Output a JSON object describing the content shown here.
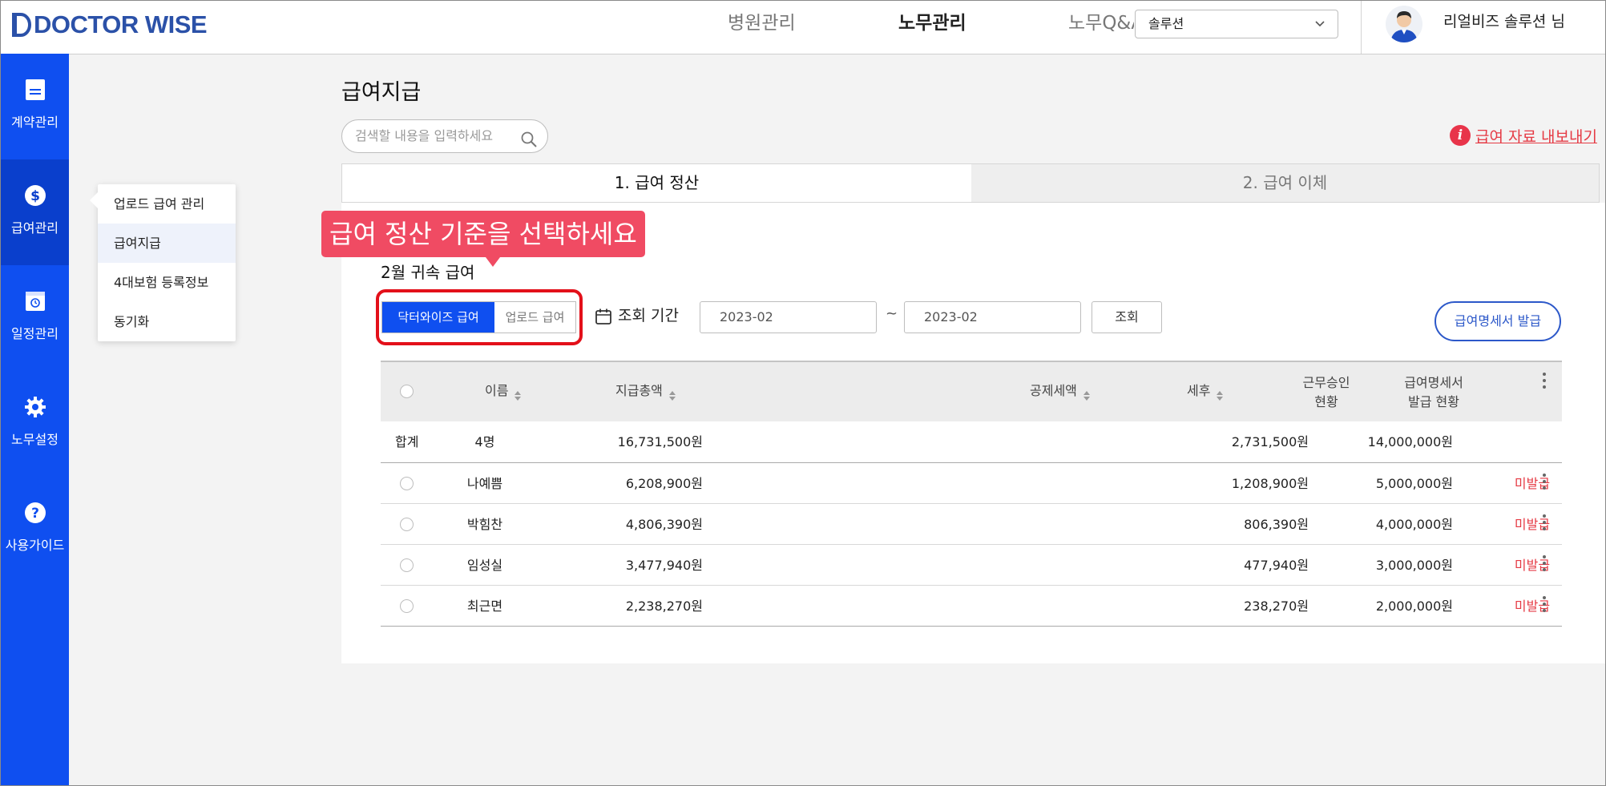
{
  "header": {
    "logo": "DOCTOR WISE",
    "nav": [
      "병원관리",
      "노무관리",
      "노무Q&A"
    ],
    "select_value": "솔루션",
    "user_name": "리얼비즈 솔루션 님"
  },
  "sidebar": {
    "items": [
      {
        "label": "계약관리",
        "icon": "document-icon"
      },
      {
        "label": "급여관리",
        "icon": "dollar-icon"
      },
      {
        "label": "일정관리",
        "icon": "calendar-icon"
      },
      {
        "label": "노무설정",
        "icon": "gear-icon"
      },
      {
        "label": "사용가이드",
        "icon": "help-icon"
      }
    ],
    "active_index": 1
  },
  "flyout": {
    "items": [
      "업로드 급여 관리",
      "급여지급",
      "4대보험 등록정보",
      "동기화"
    ],
    "selected_index": 1
  },
  "page": {
    "title": "급여지급",
    "search_placeholder": "검색할 내용을 입력하세요",
    "export_label": "급여 자료 내보내기",
    "tabs": [
      "1. 급여 정산",
      "2. 급여 이체"
    ],
    "active_tab": 0,
    "tooltip": "급여 정산 기준을 선택하세요",
    "section_title": "2월 귀속 급여",
    "segment": {
      "on": "닥터와이즈 급여",
      "off": "업로드 급여"
    },
    "period_label": "조회 기간",
    "date_from": "2023-02",
    "date_to": "2023-02",
    "tilde": "~",
    "query_button": "조회",
    "issue_button": "급여명세서 발급"
  },
  "table": {
    "headers": {
      "name": "이름",
      "pay": "지급총액",
      "deduction": "공제세액",
      "net": "세후",
      "approval_1": "근무승인",
      "approval_2": "현황",
      "payslip_1": "급여명세서",
      "payslip_2": "발급 현황"
    },
    "total": {
      "label": "합계",
      "count": "4명",
      "pay": "16,731,500원",
      "deduction": "2,731,500원",
      "net": "14,000,000원"
    },
    "rows": [
      {
        "name": "나예쁨",
        "pay": "6,208,900원",
        "deduction": "1,208,900원",
        "net": "5,000,000원",
        "status": "미발급"
      },
      {
        "name": "박힘찬",
        "pay": "4,806,390원",
        "deduction": "806,390원",
        "net": "4,000,000원",
        "status": "미발급"
      },
      {
        "name": "임성실",
        "pay": "3,477,940원",
        "deduction": "477,940원",
        "net": "3,000,000원",
        "status": "미발급"
      },
      {
        "name": "최근면",
        "pay": "2,238,270원",
        "deduction": "238,270원",
        "net": "2,000,000원",
        "status": "미발급"
      }
    ]
  },
  "colors": {
    "primary": "#0f4ff0",
    "accent": "#e53a44",
    "tooltip": "#f04b63",
    "highlight": "#e3101a"
  }
}
